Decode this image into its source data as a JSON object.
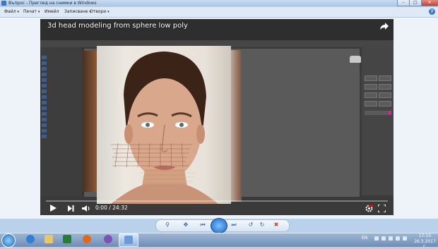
{
  "window": {
    "title": "Въпрос - Преглед на снимки в Windows",
    "minimize_icon": "minimize-icon",
    "maximize_icon": "maximize-icon",
    "close_icon": "close-icon"
  },
  "menu": {
    "items": [
      {
        "label": "Файл",
        "has_caret": true
      },
      {
        "label": "Печат",
        "has_caret": true
      },
      {
        "label": "Имейл",
        "has_caret": false
      },
      {
        "label": "Записване",
        "has_caret": true
      },
      {
        "label": "Отвори",
        "has_caret": true
      }
    ],
    "help_icon": "help-icon"
  },
  "video": {
    "title": "3d head modeling from sphere  low poly",
    "current_time": "0:00 / 24:32",
    "progress_fraction": 0.0,
    "progress_color": "#ff0000"
  },
  "photo_viewer_toolbar": {
    "buttons": [
      "zoom-icon",
      "fit-icon",
      "previous-icon",
      "slideshow-icon",
      "next-icon",
      "rotate-left-icon",
      "rotate-right-icon",
      "delete-icon"
    ]
  },
  "taskbar": {
    "language": "EN",
    "time": "17:15",
    "date": "26.3.2017 г.",
    "apps": [
      "internet-explorer-icon",
      "file-explorer-icon",
      "firefox-icon",
      "viber-icon",
      "photo-viewer-icon"
    ]
  },
  "colors": {
    "window_frame": "#b9d1ea",
    "title_bar": "#aac5e6",
    "video_background": "#000000",
    "taskbar": "#6f8db5"
  }
}
